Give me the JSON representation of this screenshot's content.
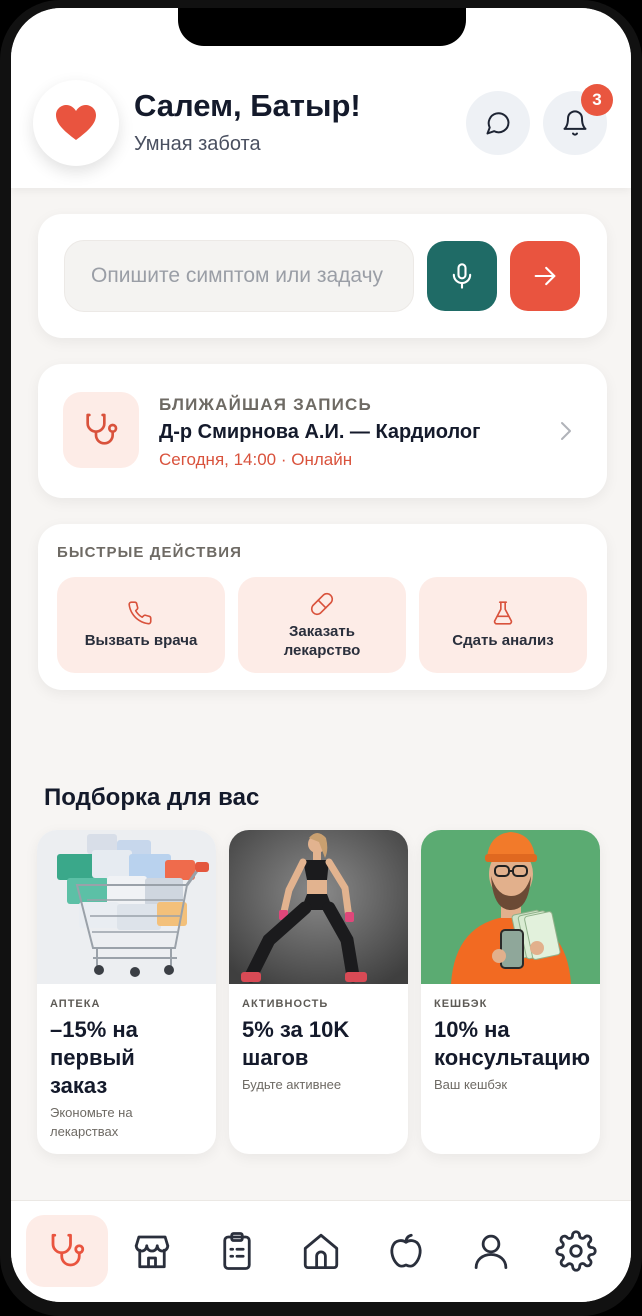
{
  "header": {
    "greeting": "Салем, Батыр!",
    "subtitle": "Умная забота",
    "notification_count": "3"
  },
  "search": {
    "placeholder": "Опишите симптом или задачу"
  },
  "appointment": {
    "kicker": "БЛИЖАЙШАЯ ЗАПИСЬ",
    "title": "Д-р Смирнова А.И. — Кардиолог",
    "time": "Сегодня, 14:00 · Онлайн"
  },
  "quick_actions": {
    "title": "БЫСТРЫЕ ДЕЙСТВИЯ",
    "items": [
      {
        "label": "Вызвать врача",
        "icon": "phone-icon"
      },
      {
        "label": "Заказать лекарство",
        "icon": "pill-icon"
      },
      {
        "label": "Сдать анализ",
        "icon": "flask-icon"
      }
    ]
  },
  "promo": {
    "heading": "Подборка для вас",
    "items": [
      {
        "tag": "АПТЕКА",
        "title": "–15% на\nпервый\nзаказ",
        "subtitle": "Экономьте на лекарствах"
      },
      {
        "tag": "АКТИВНОСТЬ",
        "title": "5% за 10K\nшагов",
        "subtitle": "Будьте активнее"
      },
      {
        "tag": "КЕШБЭК",
        "title": "10% на\nконсультацию",
        "subtitle": "Ваш кешбэк"
      }
    ]
  },
  "nav": {
    "items": [
      "stethoscope-icon",
      "store-icon",
      "clipboard-icon",
      "home-icon",
      "apple-icon",
      "user-icon",
      "settings-icon"
    ],
    "active_index": 0
  },
  "colors": {
    "accent": "#e9543f",
    "teal": "#1f6b66",
    "soft_accent": "#fdece7",
    "background": "#f7f5f3"
  }
}
